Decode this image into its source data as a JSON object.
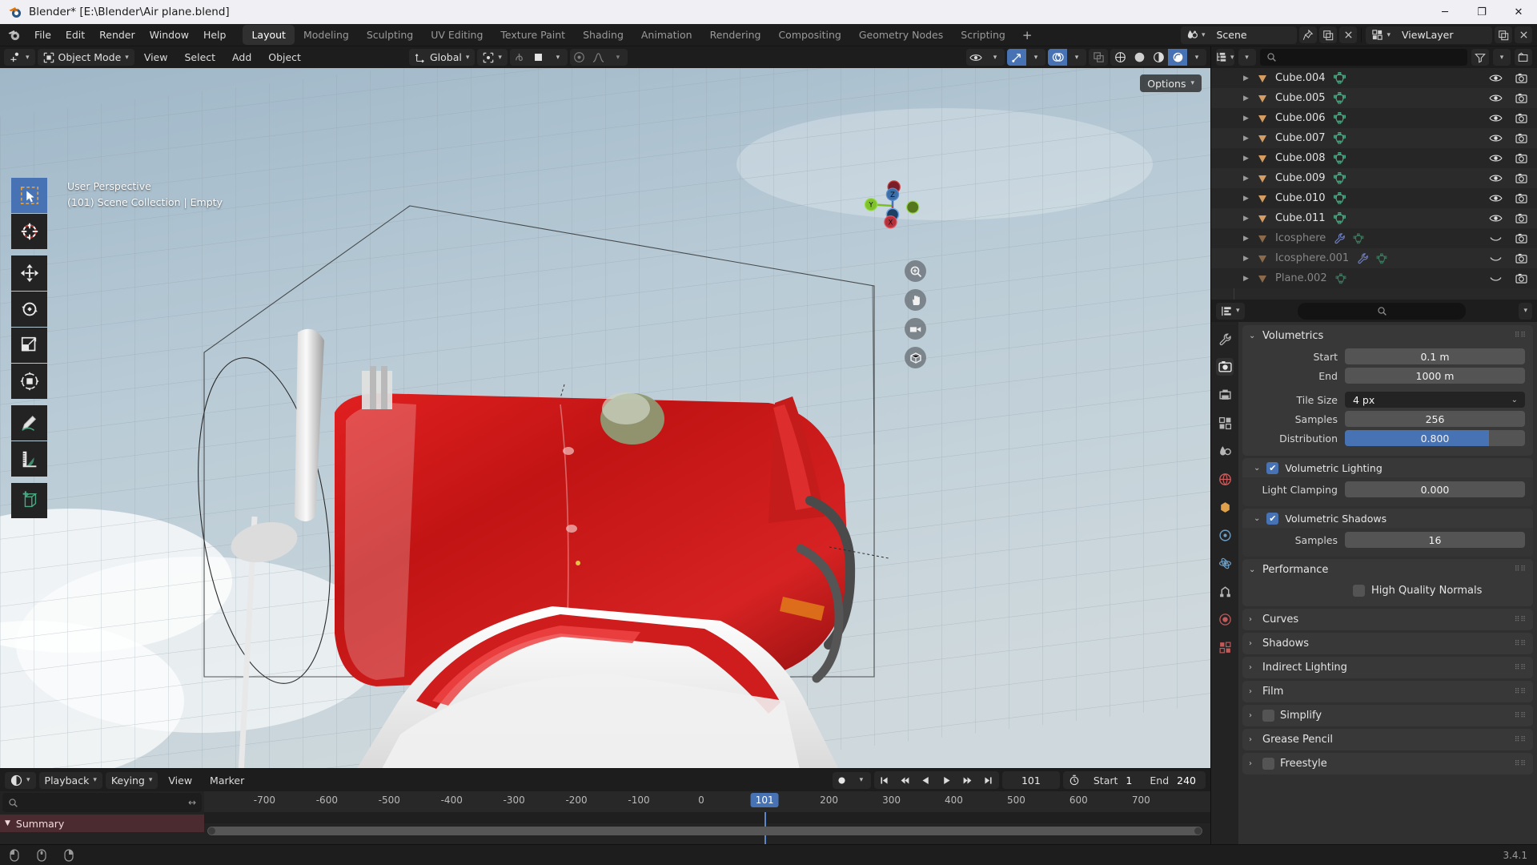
{
  "window": {
    "title": "Blender* [E:\\Blender\\Air plane.blend]",
    "minimize": "─",
    "maximize": "❐",
    "close": "✕"
  },
  "topbar": {
    "menus": [
      "File",
      "Edit",
      "Render",
      "Window",
      "Help"
    ],
    "workspaces": [
      {
        "label": "Layout",
        "active": true
      },
      {
        "label": "Modeling",
        "active": false
      },
      {
        "label": "Sculpting",
        "active": false
      },
      {
        "label": "UV Editing",
        "active": false
      },
      {
        "label": "Texture Paint",
        "active": false
      },
      {
        "label": "Shading",
        "active": false
      },
      {
        "label": "Animation",
        "active": false
      },
      {
        "label": "Rendering",
        "active": false
      },
      {
        "label": "Compositing",
        "active": false
      },
      {
        "label": "Geometry Nodes",
        "active": false
      },
      {
        "label": "Scripting",
        "active": false
      }
    ],
    "add_workspace": "+",
    "scene_name": "Scene",
    "viewlayer_name": "ViewLayer"
  },
  "viewport": {
    "header": {
      "mode": "Object Mode",
      "menus": [
        "View",
        "Select",
        "Add",
        "Object"
      ],
      "transform_orientation": "Global",
      "options_label": "Options"
    },
    "overlay": {
      "line1": "User Perspective",
      "line2": "(101) Scene Collection | Empty"
    },
    "gizmo_axes": {
      "x": "X",
      "y": "Y",
      "z": "Z"
    },
    "tools": [
      {
        "name": "tweak-select-box",
        "active": true
      },
      {
        "name": "cursor",
        "active": false
      },
      {
        "name": "move",
        "active": false
      },
      {
        "name": "rotate",
        "active": false
      },
      {
        "name": "scale",
        "active": false
      },
      {
        "name": "transform",
        "active": false
      },
      {
        "name": "annotate",
        "active": false
      },
      {
        "name": "measure",
        "active": false
      },
      {
        "name": "add-cube",
        "active": false
      }
    ]
  },
  "outliner": {
    "search_placeholder": "",
    "items": [
      {
        "name": "Cube.004",
        "dim": false,
        "modifier": false
      },
      {
        "name": "Cube.005",
        "dim": false,
        "modifier": false
      },
      {
        "name": "Cube.006",
        "dim": false,
        "modifier": false
      },
      {
        "name": "Cube.007",
        "dim": false,
        "modifier": false
      },
      {
        "name": "Cube.008",
        "dim": false,
        "modifier": false
      },
      {
        "name": "Cube.009",
        "dim": false,
        "modifier": false
      },
      {
        "name": "Cube.010",
        "dim": false,
        "modifier": false
      },
      {
        "name": "Cube.011",
        "dim": false,
        "modifier": false
      },
      {
        "name": "Icosphere",
        "dim": true,
        "modifier": true
      },
      {
        "name": "Icosphere.001",
        "dim": true,
        "modifier": true
      },
      {
        "name": "Plane.002",
        "dim": true,
        "modifier": false
      }
    ]
  },
  "properties": {
    "volumetrics": {
      "title": "Volumetrics",
      "start_label": "Start",
      "start_value": "0.1 m",
      "end_label": "End",
      "end_value": "1000 m",
      "tile_size_label": "Tile Size",
      "tile_size_value": "4 px",
      "samples_label": "Samples",
      "samples_value": "256",
      "distribution_label": "Distribution",
      "distribution_value": "0.800",
      "distribution_fill_pct": "80%",
      "volumetric_lighting_label": "Volumetric Lighting",
      "volumetric_lighting_on": true,
      "light_clamping_label": "Light Clamping",
      "light_clamping_value": "0.000",
      "volumetric_shadows_label": "Volumetric Shadows",
      "volumetric_shadows_on": true,
      "shadow_samples_label": "Samples",
      "shadow_samples_value": "16"
    },
    "performance": {
      "title": "Performance",
      "high_quality_normals_label": "High Quality Normals",
      "high_quality_normals_on": false
    },
    "closed_panels": [
      {
        "label": "Curves",
        "checkbox": false
      },
      {
        "label": "Shadows",
        "checkbox": false
      },
      {
        "label": "Indirect Lighting",
        "checkbox": false
      },
      {
        "label": "Film",
        "checkbox": false
      },
      {
        "label": "Simplify",
        "checkbox": true
      },
      {
        "label": "Grease Pencil",
        "checkbox": false
      },
      {
        "label": "Freestyle",
        "checkbox": true
      }
    ]
  },
  "timeline": {
    "menus": [
      "Playback",
      "Keying",
      "View",
      "Marker"
    ],
    "current_frame": "101",
    "start_label": "Start",
    "start_value": "1",
    "end_label": "End",
    "end_value": "240",
    "summary_label": "Summary",
    "search_placeholder": "",
    "ticks": [
      {
        "label": "-700",
        "pos": 6.0
      },
      {
        "label": "-600",
        "pos": 12.2
      },
      {
        "label": "-500",
        "pos": 18.4
      },
      {
        "label": "-400",
        "pos": 24.6
      },
      {
        "label": "-300",
        "pos": 30.8
      },
      {
        "label": "-200",
        "pos": 37.0
      },
      {
        "label": "-100",
        "pos": 43.2
      },
      {
        "label": "0",
        "pos": 49.4
      },
      {
        "label": "200",
        "pos": 62.1
      },
      {
        "label": "300",
        "pos": 68.3
      },
      {
        "label": "400",
        "pos": 74.5
      },
      {
        "label": "500",
        "pos": 80.7
      },
      {
        "label": "600",
        "pos": 86.9
      },
      {
        "label": "700",
        "pos": 93.1
      }
    ],
    "playhead_pos": 55.7
  },
  "statusbar": {
    "version": "3.4.1"
  },
  "colors": {
    "accent_blue": "#4772b3",
    "panel_bg": "#383838",
    "editor_bg": "#303030",
    "header_bg": "#1d1d1d",
    "mesh_green": "#4aa882",
    "object_orange": "#d59d62",
    "summary_red": "#4b2b2f"
  }
}
